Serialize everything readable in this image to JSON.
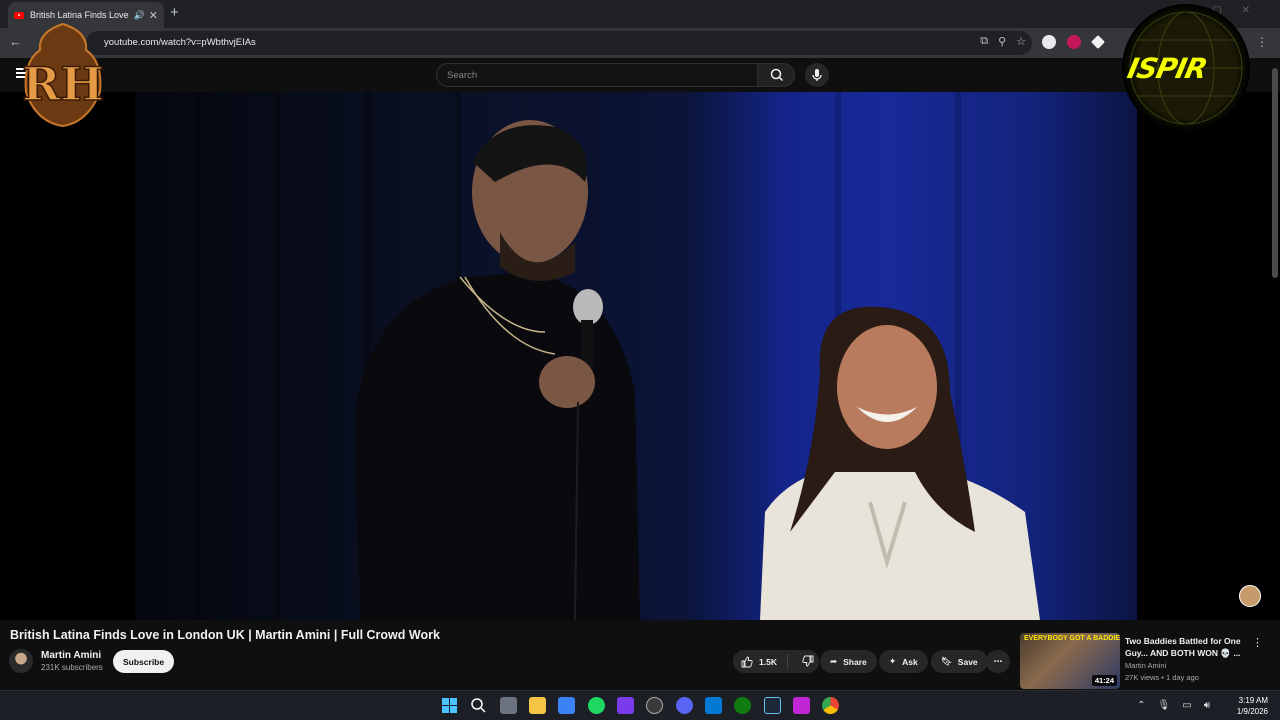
{
  "browser": {
    "tab_title": "British Latina Finds Love in",
    "url": "youtube.com/watch?v=pWbthvjEIAs"
  },
  "youtube": {
    "search_placeholder": "Search"
  },
  "video": {
    "title": "British Latina Finds Love in London UK | Martin Amini | Full Crowd Work",
    "channel": "Martin Amini",
    "subscribers": "231K subscribers",
    "subscribe_label": "Subscribe",
    "likes": "1.5K",
    "share_label": "Share",
    "ask_label": "Ask",
    "save_label": "Save"
  },
  "recommended": {
    "thumb_text": "EVERYBODY GOT A BADDIE",
    "duration": "41:24",
    "title": "Two Baddies Battled for One Guy... AND BOTH WON 💀 ...",
    "channel": "Martin Amini",
    "meta": "27K views • 1 day ago"
  },
  "overlays": {
    "left_logo_text": "RH",
    "right_logo_text": "ISPIR"
  },
  "taskbar": {
    "time": "3:19 AM",
    "date": "1/9/2026"
  },
  "icons": [
    "back-icon",
    "speaker-icon",
    "close-icon",
    "plus-icon",
    "cast-icon",
    "zoom-icon",
    "star-icon",
    "menu-icon",
    "search-icon",
    "mic-icon",
    "like-icon",
    "dislike-icon",
    "share-icon",
    "sparkle-icon",
    "bookmark-icon",
    "more-icon",
    "windows-start-icon"
  ]
}
